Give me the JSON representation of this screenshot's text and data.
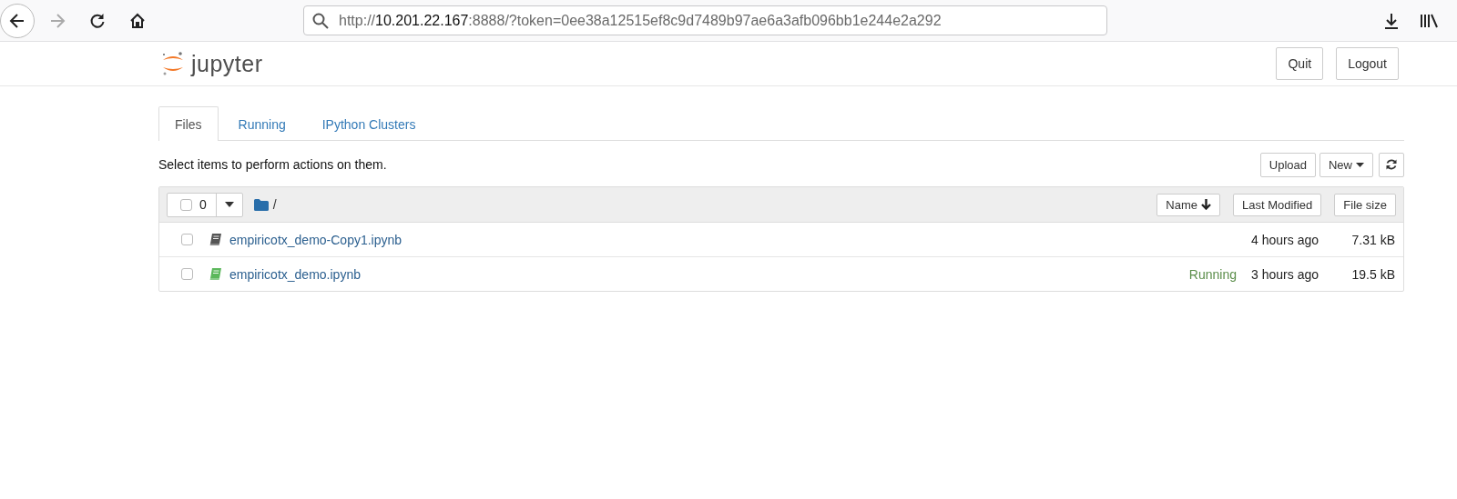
{
  "browser": {
    "url_scheme": "http://",
    "url_host": "10.201.22.167",
    "url_rest": ":8888/?token=0ee38a12515ef8c9d7489b97ae6a3afb096bb1e244e2a292"
  },
  "header": {
    "logo_text": "jupyter",
    "buttons": [
      "Quit",
      "Logout"
    ]
  },
  "tabs": [
    {
      "label": "Files",
      "selected": true
    },
    {
      "label": "Running",
      "selected": false
    },
    {
      "label": "IPython Clusters",
      "selected": false
    }
  ],
  "toolbar": {
    "instructions": "Select items to perform actions on them.",
    "upload": "Upload",
    "new": "New"
  },
  "list_header": {
    "select_all_checked": false,
    "selected_count": "0",
    "path": "/",
    "sort_buttons": [
      "Name",
      "Last Modified",
      "File size"
    ]
  },
  "files": [
    {
      "name": "empiricotx_demo-Copy1.ipynb",
      "checked": false,
      "running": false,
      "modified": "4 hours ago",
      "size": "7.31 kB"
    },
    {
      "name": "empiricotx_demo.ipynb",
      "checked": false,
      "running": true,
      "status": "Running",
      "modified": "3 hours ago",
      "size": "19.5 kB"
    }
  ]
}
